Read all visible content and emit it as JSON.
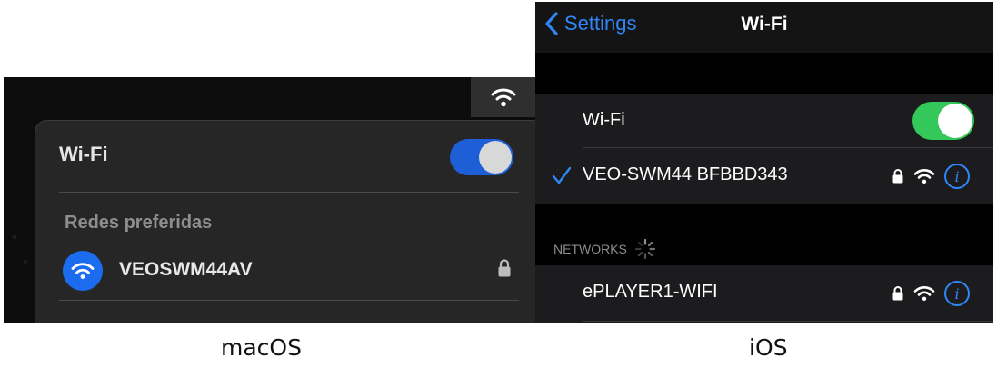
{
  "macos": {
    "menu_title": "Wi-Fi",
    "wifi_enabled": true,
    "section_label": "Redes preferidas",
    "networks": [
      {
        "name": "VEOSWM44AV",
        "locked": true,
        "icon": "wifi-icon",
        "icon_color": "#1c6cf0"
      }
    ],
    "toggle_color": "#1e5fd8"
  },
  "ios": {
    "back_label": "Settings",
    "nav_title": "Wi-Fi",
    "wifi_label": "Wi-Fi",
    "wifi_enabled": true,
    "toggle_color": "#34c759",
    "connected_network": {
      "name": "VEO-SWM44 BFBBD343",
      "locked": true,
      "checked": true
    },
    "networks_header": "NETWORKS",
    "networks": [
      {
        "name": "ePLAYER1-WIFI",
        "locked": true
      }
    ],
    "info_glyph": "i",
    "accent_color": "#2f86f6"
  },
  "captions": {
    "left": "macOS",
    "right": "iOS"
  }
}
